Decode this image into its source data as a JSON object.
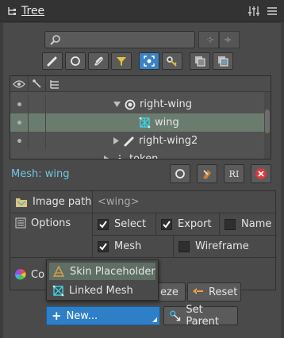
{
  "title_tab": {
    "label": "Tree",
    "icon": "tree-icon"
  },
  "toolbar": {
    "search": {
      "placeholder": "",
      "value": "",
      "icon": "search-icon"
    },
    "nav": [
      {
        "icon": "arrow-left-icon"
      },
      {
        "icon": "arrow-right-icon"
      }
    ],
    "filters": [
      {
        "icon": "bone-filter-icon",
        "active": false
      },
      {
        "icon": "slot-filter-icon",
        "active": false
      },
      {
        "icon": "attachment-filter-icon",
        "active": false
      },
      {
        "icon": "funnel-icon",
        "active": false
      },
      {
        "icon": "focus-icon",
        "active": true
      },
      {
        "icon": "key-icon",
        "active": false
      },
      {
        "icon": "collapse-icon",
        "active": false
      },
      {
        "icon": "expand-icon",
        "active": false
      }
    ]
  },
  "tree": {
    "columns": [
      {
        "icon": "eye-icon"
      },
      {
        "icon": "bone-icon"
      },
      {
        "icon": "hierarchy-icon"
      }
    ],
    "rows": [
      {
        "label": "right-wing",
        "icon": "slot-icon",
        "expanded": true,
        "selected": false
      },
      {
        "label": "wing",
        "icon": "mesh-icon",
        "selected": true
      },
      {
        "label": "right-wing2",
        "icon": "bone-icon",
        "expanded": false,
        "selected": false
      },
      {
        "label": "token",
        "icon": "bone-icon",
        "expanded": false,
        "selected": false
      }
    ]
  },
  "mesh_section": {
    "label": "Mesh: wing",
    "buttons": [
      {
        "icon": "slot-circle-icon"
      },
      {
        "icon": "weights-icon"
      },
      {
        "icon": "rename-icon",
        "text": "RI"
      },
      {
        "icon": "delete-icon",
        "color": "#d63b3b"
      }
    ]
  },
  "properties": {
    "image_path": {
      "label": "Image path",
      "value": "<wing>"
    },
    "options": {
      "label": "Options",
      "select": {
        "label": "Select",
        "checked": true
      },
      "export": {
        "label": "Export",
        "checked": true
      },
      "name": {
        "label": "Name",
        "checked": false
      },
      "mesh": {
        "label": "Mesh",
        "checked": true
      },
      "wireframe": {
        "label": "Wireframe",
        "checked": false
      }
    },
    "color": {
      "label": "Co"
    }
  },
  "popup_menu": {
    "items": [
      {
        "label": "Skin Placeholder",
        "icon": "skin-placeholder-icon",
        "highlighted": true
      },
      {
        "label": "Linked Mesh",
        "icon": "linked-mesh-icon",
        "highlighted": false
      }
    ]
  },
  "actions": {
    "freeze_partial": "eze",
    "reset": "Reset",
    "new": "New...",
    "set_parent": "Set Parent"
  },
  "colors": {
    "accent": "#2e7fc7",
    "mesh_label": "#6fc6e6",
    "selected_row": "#6a7c6e",
    "delete": "#d63b3b",
    "funnel": "#e8c23a"
  }
}
